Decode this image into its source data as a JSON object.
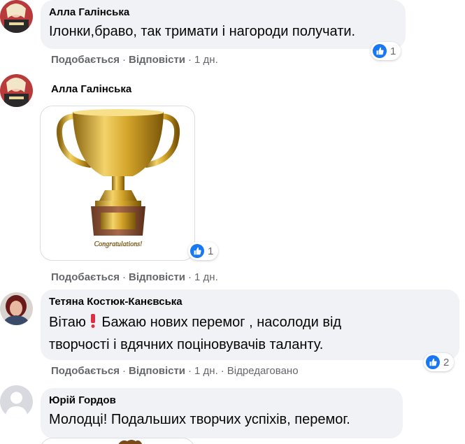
{
  "comments": [
    {
      "author": "Алла Галінська",
      "text": "Ілонки,браво, так тримати і нагороди получати.",
      "like_label": "Подобається",
      "reply_label": "Відповісти",
      "time": "1 дн.",
      "reactions": "1"
    },
    {
      "author": "Алла Галінська",
      "sticker_caption": "Congratulations!",
      "like_label": "Подобається",
      "reply_label": "Відповісти",
      "time": "1 дн.",
      "reactions": "1"
    },
    {
      "author": "Тетяна Костюк-Канєвська",
      "text_line1": "Вітаю",
      "text_line1_rest": " Бажаю нових перемог , насолоди від",
      "text_line2": "творчості і вдячних поціновувачів таланту.",
      "like_label": "Подобається",
      "reply_label": "Відповісти",
      "time": "1 дн.",
      "edited": "Відредаговано",
      "reactions": "2"
    },
    {
      "author": "Юрій Гордов",
      "text": "Молодці! Подальших творчих успіхів, перемог."
    }
  ],
  "colors": {
    "bubble": "#f0f2f5",
    "meta": "#65676b",
    "like_blue": "#1877f2",
    "gold": "#d4a52a"
  },
  "icons": {
    "reaction": "like-icon",
    "exclamation": "red-exclamation-emoji"
  }
}
